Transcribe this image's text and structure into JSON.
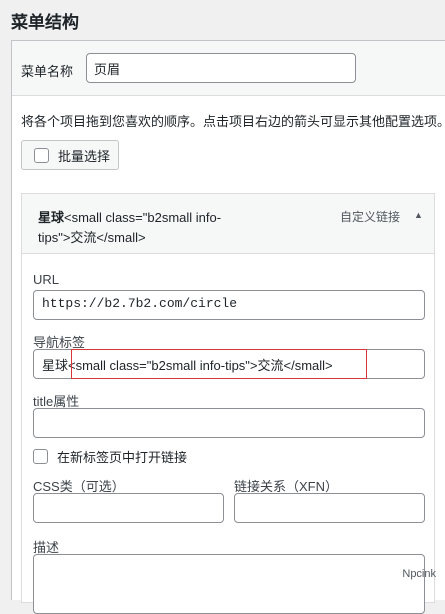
{
  "page": {
    "title": "菜单结构"
  },
  "menu_name": {
    "label": "菜单名称",
    "value": "页眉"
  },
  "instructions": "将各个项目拖到您喜欢的顺序。点击项目右边的箭头可显示其他配置选项。",
  "bulk_select": {
    "label": "批量选择"
  },
  "menu_item": {
    "title_line1": "星球<small class=\"b2small info-",
    "title_line2": "tips\">交流</small>",
    "title_bold_prefix": "星球",
    "type": "自定义链接",
    "arrow": "▲",
    "url_label": "URL",
    "url_value": "https://b2.7b2.com/circle",
    "nav_label": "导航标签",
    "nav_value_prefix": "星球",
    "nav_value_rest": "<small class=\"b2small info-tips\">交流</small>",
    "title_attr_label": "title属性",
    "title_attr_value": "",
    "newtab_label": "在新标签页中打开链接",
    "css_label": "CSS类（可选）",
    "css_value": "",
    "xfn_label": "链接关系（XFN）",
    "xfn_value": "",
    "desc_label": "描述",
    "desc_value": ""
  },
  "watermark": "Npcink"
}
